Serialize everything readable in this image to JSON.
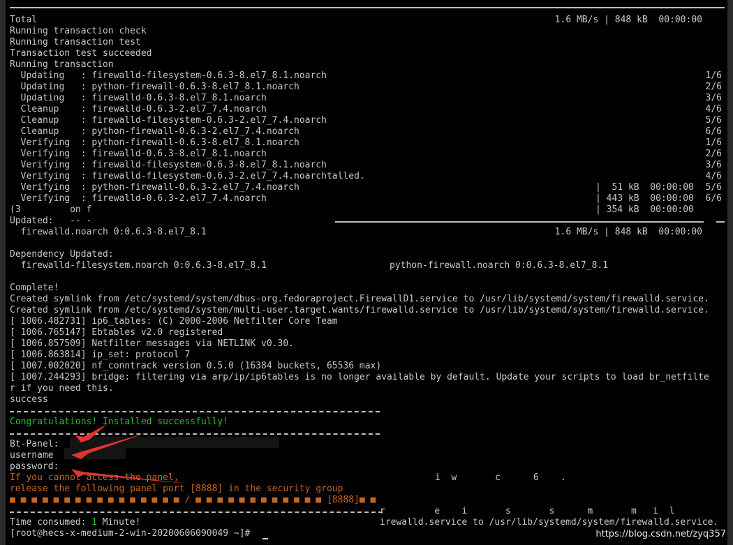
{
  "colors": {
    "terminal_bg": "#000000",
    "text": "#c8c8c8",
    "success_green": "#2bbf2b",
    "warning_orange": "#c8661e",
    "arrow_red": "#e3342f"
  },
  "lines": [
    {
      "left": "Total",
      "right": "1.6 MB/s | 848 kB  00:00:00"
    },
    {
      "left": "Running transaction check"
    },
    {
      "left": "Running transaction test"
    },
    {
      "left": "Transaction test succeeded"
    },
    {
      "left": "Running transaction"
    },
    {
      "left": "  Updating   : firewalld-filesystem-0.6.3-8.el7_8.1.noarch",
      "right": "1/6"
    },
    {
      "left": "  Updating   : python-firewall-0.6.3-8.el7_8.1.noarch",
      "right": "2/6"
    },
    {
      "left": "  Updating   : firewalld-0.6.3-8.el7_8.1.noarch",
      "right": "3/6"
    },
    {
      "left": "  Cleanup    : firewalld-0.6.3-2.el7_7.4.noarch",
      "right": "4/6"
    },
    {
      "left": "  Cleanup    : firewalld-filesystem-0.6.3-2.el7_7.4.noarch",
      "right": "5/6"
    },
    {
      "left": "  Cleanup    : python-firewall-0.6.3-2.el7_7.4.noarch",
      "right": "6/6"
    },
    {
      "left": "  Verifying  : python-firewall-0.6.3-8.el7_8.1.noarch",
      "right": "1/6"
    },
    {
      "left": "  Verifying  : firewalld-0.6.3-8.el7_8.1.noarch",
      "right": "2/6"
    },
    {
      "left": "  Verifying  : firewalld-filesystem-0.6.3-8.el7_8.1.noarch",
      "right": "3/6"
    },
    {
      "left": "  Verifying  : firewalld-filesystem-0.6.3-2.el7_7.4.noarchtalled.",
      "right": "4/6"
    },
    {
      "left": "  Verifying  : python-firewall-0.6.3-2.el7_7.4.noarch",
      "mid": "|  51 kB  00:00:00",
      "right": "5/6"
    },
    {
      "left": "  Verifying  : firewalld-0.6.3-2.el7_7.4.noarch",
      "mid": "| 443 kB  00:00:00",
      "right": "6/6"
    },
    {
      "left": "(3         on f",
      "mid": "| 354 kB  00:00:00"
    },
    {
      "left": "Updated:   -- -"
    },
    {
      "left": "  firewalld.noarch 0:0.6.3-8.el7_8.1",
      "right": "1.6 MB/s | 848 kB  00:00:00"
    },
    {
      "left": ""
    },
    {
      "left": "Dependency Updated:"
    },
    {
      "left": "  firewalld-filesystem.noarch 0:0.6.3-8.el7_8.1",
      "mid": "python-firewall.noarch 0:0.6.3-8.el7_8.1"
    },
    {
      "left": ""
    },
    {
      "left": "Complete!"
    },
    {
      "left": "Created symlink from /etc/systemd/system/dbus-org.fedoraproject.FirewallD1.service to /usr/lib/systemd/system/firewalld.service."
    },
    {
      "left": "Created symlink from /etc/systemd/system/multi-user.target.wants/firewalld.service to /usr/lib/systemd/system/firewalld.service."
    },
    {
      "left": "[ 1006.482731] ip6_tables: (C) 2000-2006 Netfilter Core Team"
    },
    {
      "left": "[ 1006.765147] Ebtables v2.0 registered"
    },
    {
      "left": "[ 1006.857509] Netfilter messages via NETLINK v0.30."
    },
    {
      "left": "[ 1006.863814] ip_set: protocol 7"
    },
    {
      "left": "[ 1007.002020] nf_conntrack version 0.5.0 (16384 buckets, 65536 max)"
    },
    {
      "left": "[ 1007.244293] bridge: filtering via arp/ip/ip6tables is no longer available by default. Update your scripts to load br_netfilte"
    },
    {
      "left": "r if you need this."
    },
    {
      "left": "success"
    },
    {
      "left": ""
    },
    {
      "left": "Congratulations! Installed successfully!",
      "color": "green"
    },
    {
      "left": ""
    },
    {
      "left": "Bt-Panel:"
    },
    {
      "left": "username"
    },
    {
      "left": "password:"
    },
    {
      "left": "If you cannot access the panel,",
      "mid": "i  w       c      6    .",
      "color": "orange"
    },
    {
      "left": "release the following panel port [8888] in the security group",
      "color": "orange"
    },
    {
      "left": "■ ■ ■ ■ ■ ■ ■ ■ ■ ■ ■ ■ ■ ■ ■ ■ / ■ ■ ■ ■ ■ ■ ■ ■ ■ ■ ■ ■ [8888]■ ■",
      "color": "orange"
    },
    {
      "left": "",
      "mid": "r         e    i       s       s      m       m   i  l"
    },
    {
      "left": "Time consumed: ",
      "green_part": "1",
      "after": " Minute!",
      "mid": "irewalld.service to /usr/lib/systemd/system/firewalld.service."
    },
    {
      "left": "[root@hecs-x-medium-2-win-20200606090049 ~]# "
    }
  ],
  "watermark": "https://blog.csdn.net/zyq357"
}
